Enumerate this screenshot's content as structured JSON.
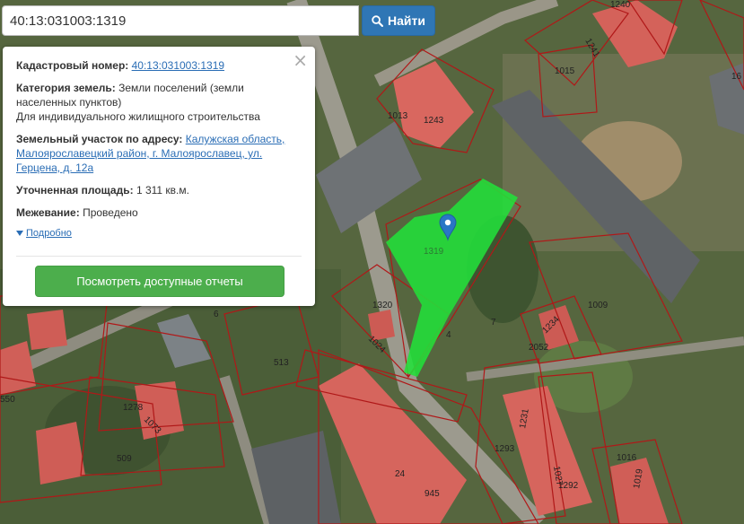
{
  "search": {
    "value": "40:13:031003:1319",
    "button_label": "Найти"
  },
  "info": {
    "cadastral_label": "Кадастровый номер:",
    "cadastral_value": "40:13:031003:1319",
    "category_label": "Категория земель:",
    "category_value_1": "Земли поселений (земли",
    "category_value_2": "населенных пунктов)",
    "category_value_3": "Для индивидуального жилищного строительства",
    "address_label": "Земельный участок по адресу:",
    "address_value_1": "Калужская область,",
    "address_value_2": "Малоярославецкий район, г. Малоярославец, ул.",
    "address_value_3": "Герцена, д. 12а",
    "area_label": "Уточненная площадь:",
    "area_value": "1 311 кв.м.",
    "survey_label": "Межевание:",
    "survey_value": "Проведено",
    "more_label": "Подробно",
    "reports_button": "Посмотреть доступные отчеты",
    "close_symbol": "×"
  },
  "map": {
    "parcel_labels": [
      "1240",
      "1241",
      "1015",
      "16",
      "1013",
      "1243",
      "1319",
      "1320",
      "1009",
      "6",
      "1024",
      "4",
      "7",
      "2052",
      "1234",
      "513",
      "550",
      "1278",
      "1073",
      "509",
      "24",
      "945",
      "1293",
      "1231",
      "1027",
      "1292",
      "1016",
      "1019"
    ],
    "marker": "map-marker-icon",
    "colors": {
      "selected_parcel": "#22e03a",
      "boundary": "#b01818",
      "roof_red": "#d9675f",
      "roof_grey": "#6b6e70"
    }
  }
}
